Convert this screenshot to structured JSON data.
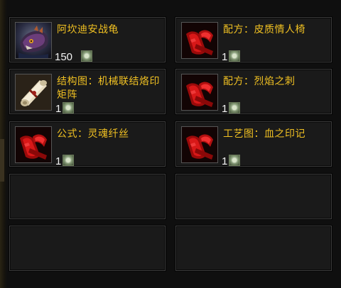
{
  "items": [
    {
      "name": "阿坎迪安战龟",
      "qty": "150",
      "icon": "turtle-icon"
    },
    {
      "name": "配方：皮质情人椅",
      "qty": "1",
      "icon": "red-scroll-icon"
    },
    {
      "name": "结构图：机械联结烙印矩阵",
      "qty": "1",
      "icon": "parchment-scroll-icon"
    },
    {
      "name": "配方：烈焰之刺",
      "qty": "1",
      "icon": "red-scroll-icon"
    },
    {
      "name": "公式：灵魂纤丝",
      "qty": "1",
      "icon": "red-scroll-icon"
    },
    {
      "name": "工艺图：血之印记",
      "qty": "1",
      "icon": "red-scroll-icon"
    }
  ],
  "currency_icon": "currency-icon",
  "colors": {
    "item_name": "#f0c022",
    "quantity": "#f2f2f2",
    "slot_bg": "#1a1a1a",
    "slot_border": "#3b3b3b",
    "page_bg": "#0f0f0f"
  }
}
